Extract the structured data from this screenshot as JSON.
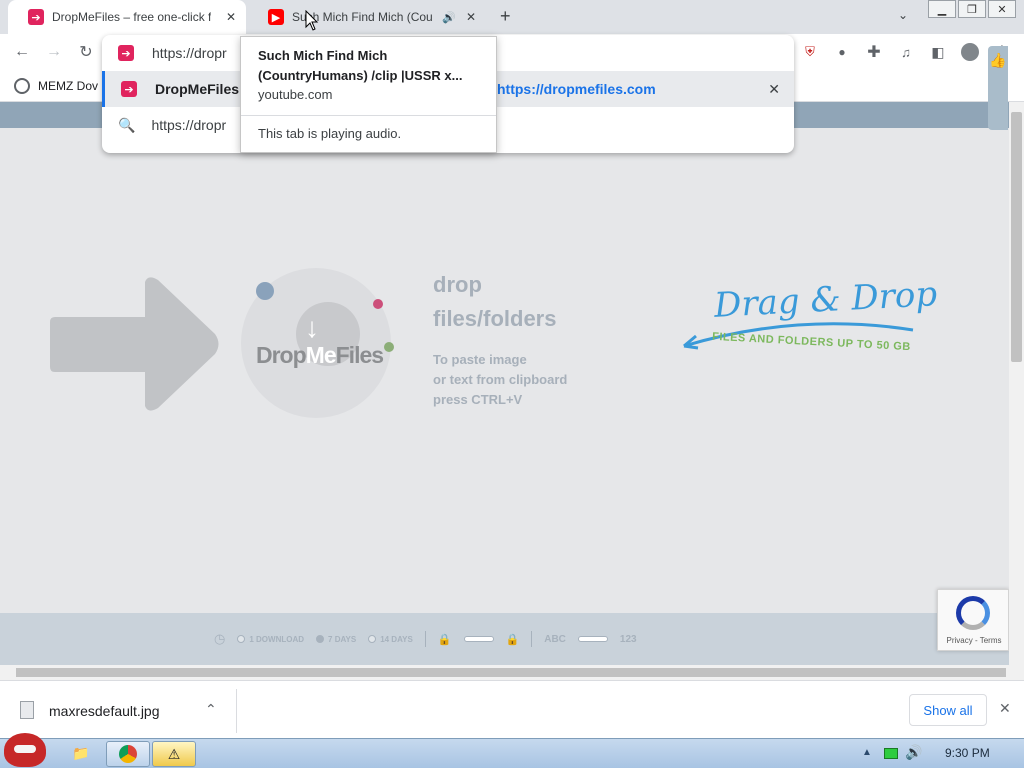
{
  "tabs": [
    {
      "title": "DropMeFiles – free one-click f",
      "active": true,
      "favicon": "dropmefiles-icon"
    },
    {
      "title": "Such Mich Find Mich (Cou",
      "active": false,
      "favicon": "youtube-icon",
      "audio": true
    }
  ],
  "toolbar": {
    "omnibox_value": "https://dropr"
  },
  "bookmarks": [
    {
      "label": "MEMZ Dov"
    }
  ],
  "omnibox_dropdown": {
    "suggestion1_title": "DropMeFiles",
    "suggestion1_url": "https://dropmefiles.com",
    "suggestion2_text": "https://dropr"
  },
  "tooltip": {
    "title": "Such Mich Find Mich (CountryHumans) /clip |USSR x...",
    "domain": "youtube.com",
    "status": "This tab is playing audio."
  },
  "page": {
    "logo_text_drop": "Drop",
    "logo_text_me": "Me",
    "logo_text_files": "Files",
    "drop_line1": "drop",
    "drop_line2": "files/folders",
    "paste_line1": "To paste image",
    "paste_line2": "or text from clipboard",
    "paste_line3": "press CTRL+V",
    "dragdrop_title": "Drag & Drop",
    "dragdrop_sub": "FILES AND FOLDERS UP TO 50 GB",
    "options": {
      "opt1": "1 DOWNLOAD",
      "opt2": "7 DAYS",
      "opt3": "14 DAYS",
      "abc": "ABC",
      "num": "123"
    },
    "recaptcha": "Privacy - Terms"
  },
  "downloads": {
    "file": "maxresdefault.jpg",
    "show_all": "Show all"
  },
  "taskbar": {
    "time": "9:30 PM"
  },
  "colors": {
    "accent_blue": "#1a73e8",
    "dmf_pink": "#e0245e",
    "dragdrop_blue": "#3a9ad9",
    "dragdrop_green": "#7cb85d"
  }
}
